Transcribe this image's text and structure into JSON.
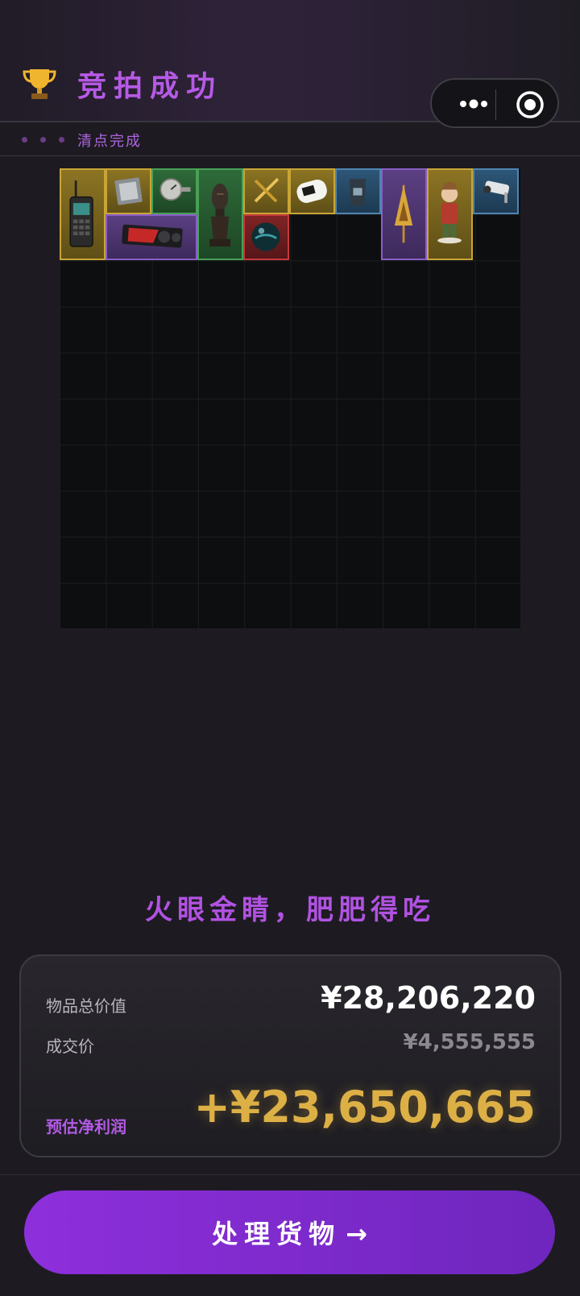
{
  "header": {
    "title": "竞拍成功",
    "trophy_icon": "trophy-icon",
    "more_icon": "more-dots-icon",
    "capsule_close_icon": "target-circle-icon"
  },
  "subbar": {
    "label": "清点完成"
  },
  "inventory": {
    "items": [
      {
        "name": "walkie-talkie",
        "rarity": "gold"
      },
      {
        "name": "cpu-chip",
        "rarity": "gold"
      },
      {
        "name": "pressure-gauge",
        "rarity": "green"
      },
      {
        "name": "carved-wooden-statue",
        "rarity": "green"
      },
      {
        "name": "gold-crossed-swords",
        "rarity": "gold"
      },
      {
        "name": "pulse-oximeter",
        "rarity": "gold"
      },
      {
        "name": "coffee-bag",
        "rarity": "blue"
      },
      {
        "name": "golden-spearhead-ornament",
        "rarity": "purple"
      },
      {
        "name": "boy-figurine",
        "rarity": "gold"
      },
      {
        "name": "security-camera",
        "rarity": "blue"
      },
      {
        "name": "graphics-card",
        "rarity": "purple"
      },
      {
        "name": "dark-orb",
        "rarity": "red"
      }
    ],
    "colors": {
      "gold": "#c9a536",
      "green": "#48a056",
      "purple": "#8a5fc6",
      "blue": "#4f85b3",
      "red": "#c63a3a"
    }
  },
  "slogan": "火眼金睛，肥肥得吃",
  "summary": {
    "total_label": "物品总价值",
    "total_value": "¥28,206,220",
    "deal_label": "成交价",
    "deal_value": "¥4,555,555",
    "profit_label": "预估净利润",
    "profit_value": "+¥23,650,665"
  },
  "cta": {
    "label": "处理货物",
    "arrow": "→"
  }
}
